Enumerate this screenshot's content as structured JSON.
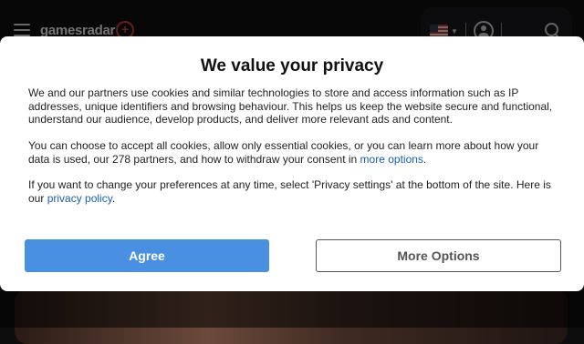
{
  "header": {
    "logo_text": "gamesradar",
    "logo_plus": "+"
  },
  "dialog": {
    "title": "We value your privacy",
    "paragraph1": "We and our partners use cookies and similar technologies to store and access information such as IP addresses, unique identifiers and browsing behaviour. This helps us keep the website secure and functional, understand our audience, develop products, and deliver more relevant ads and content.",
    "paragraph2_before": "You can choose to accept all cookies, allow only essential cookies, or you can learn more about how your data is used, our 278 partners, and how to withdraw your consent in ",
    "paragraph2_link": "more options",
    "paragraph2_after": ".",
    "paragraph3_before": "If you want to change your preferences at any time, select 'Privacy settings' at the bottom of the site. Here is our ",
    "paragraph3_link": "privacy policy",
    "paragraph3_after": ".",
    "agree_label": "Agree",
    "more_options_label": "More Options"
  },
  "colors": {
    "agree_bg": "#4a90e2",
    "link": "#1a5fb4",
    "logo_accent": "#e0452c"
  },
  "icons": [
    "hamburger-menu-icon",
    "us-flag-icon",
    "chevron-down-icon",
    "user-account-icon",
    "search-icon"
  ]
}
